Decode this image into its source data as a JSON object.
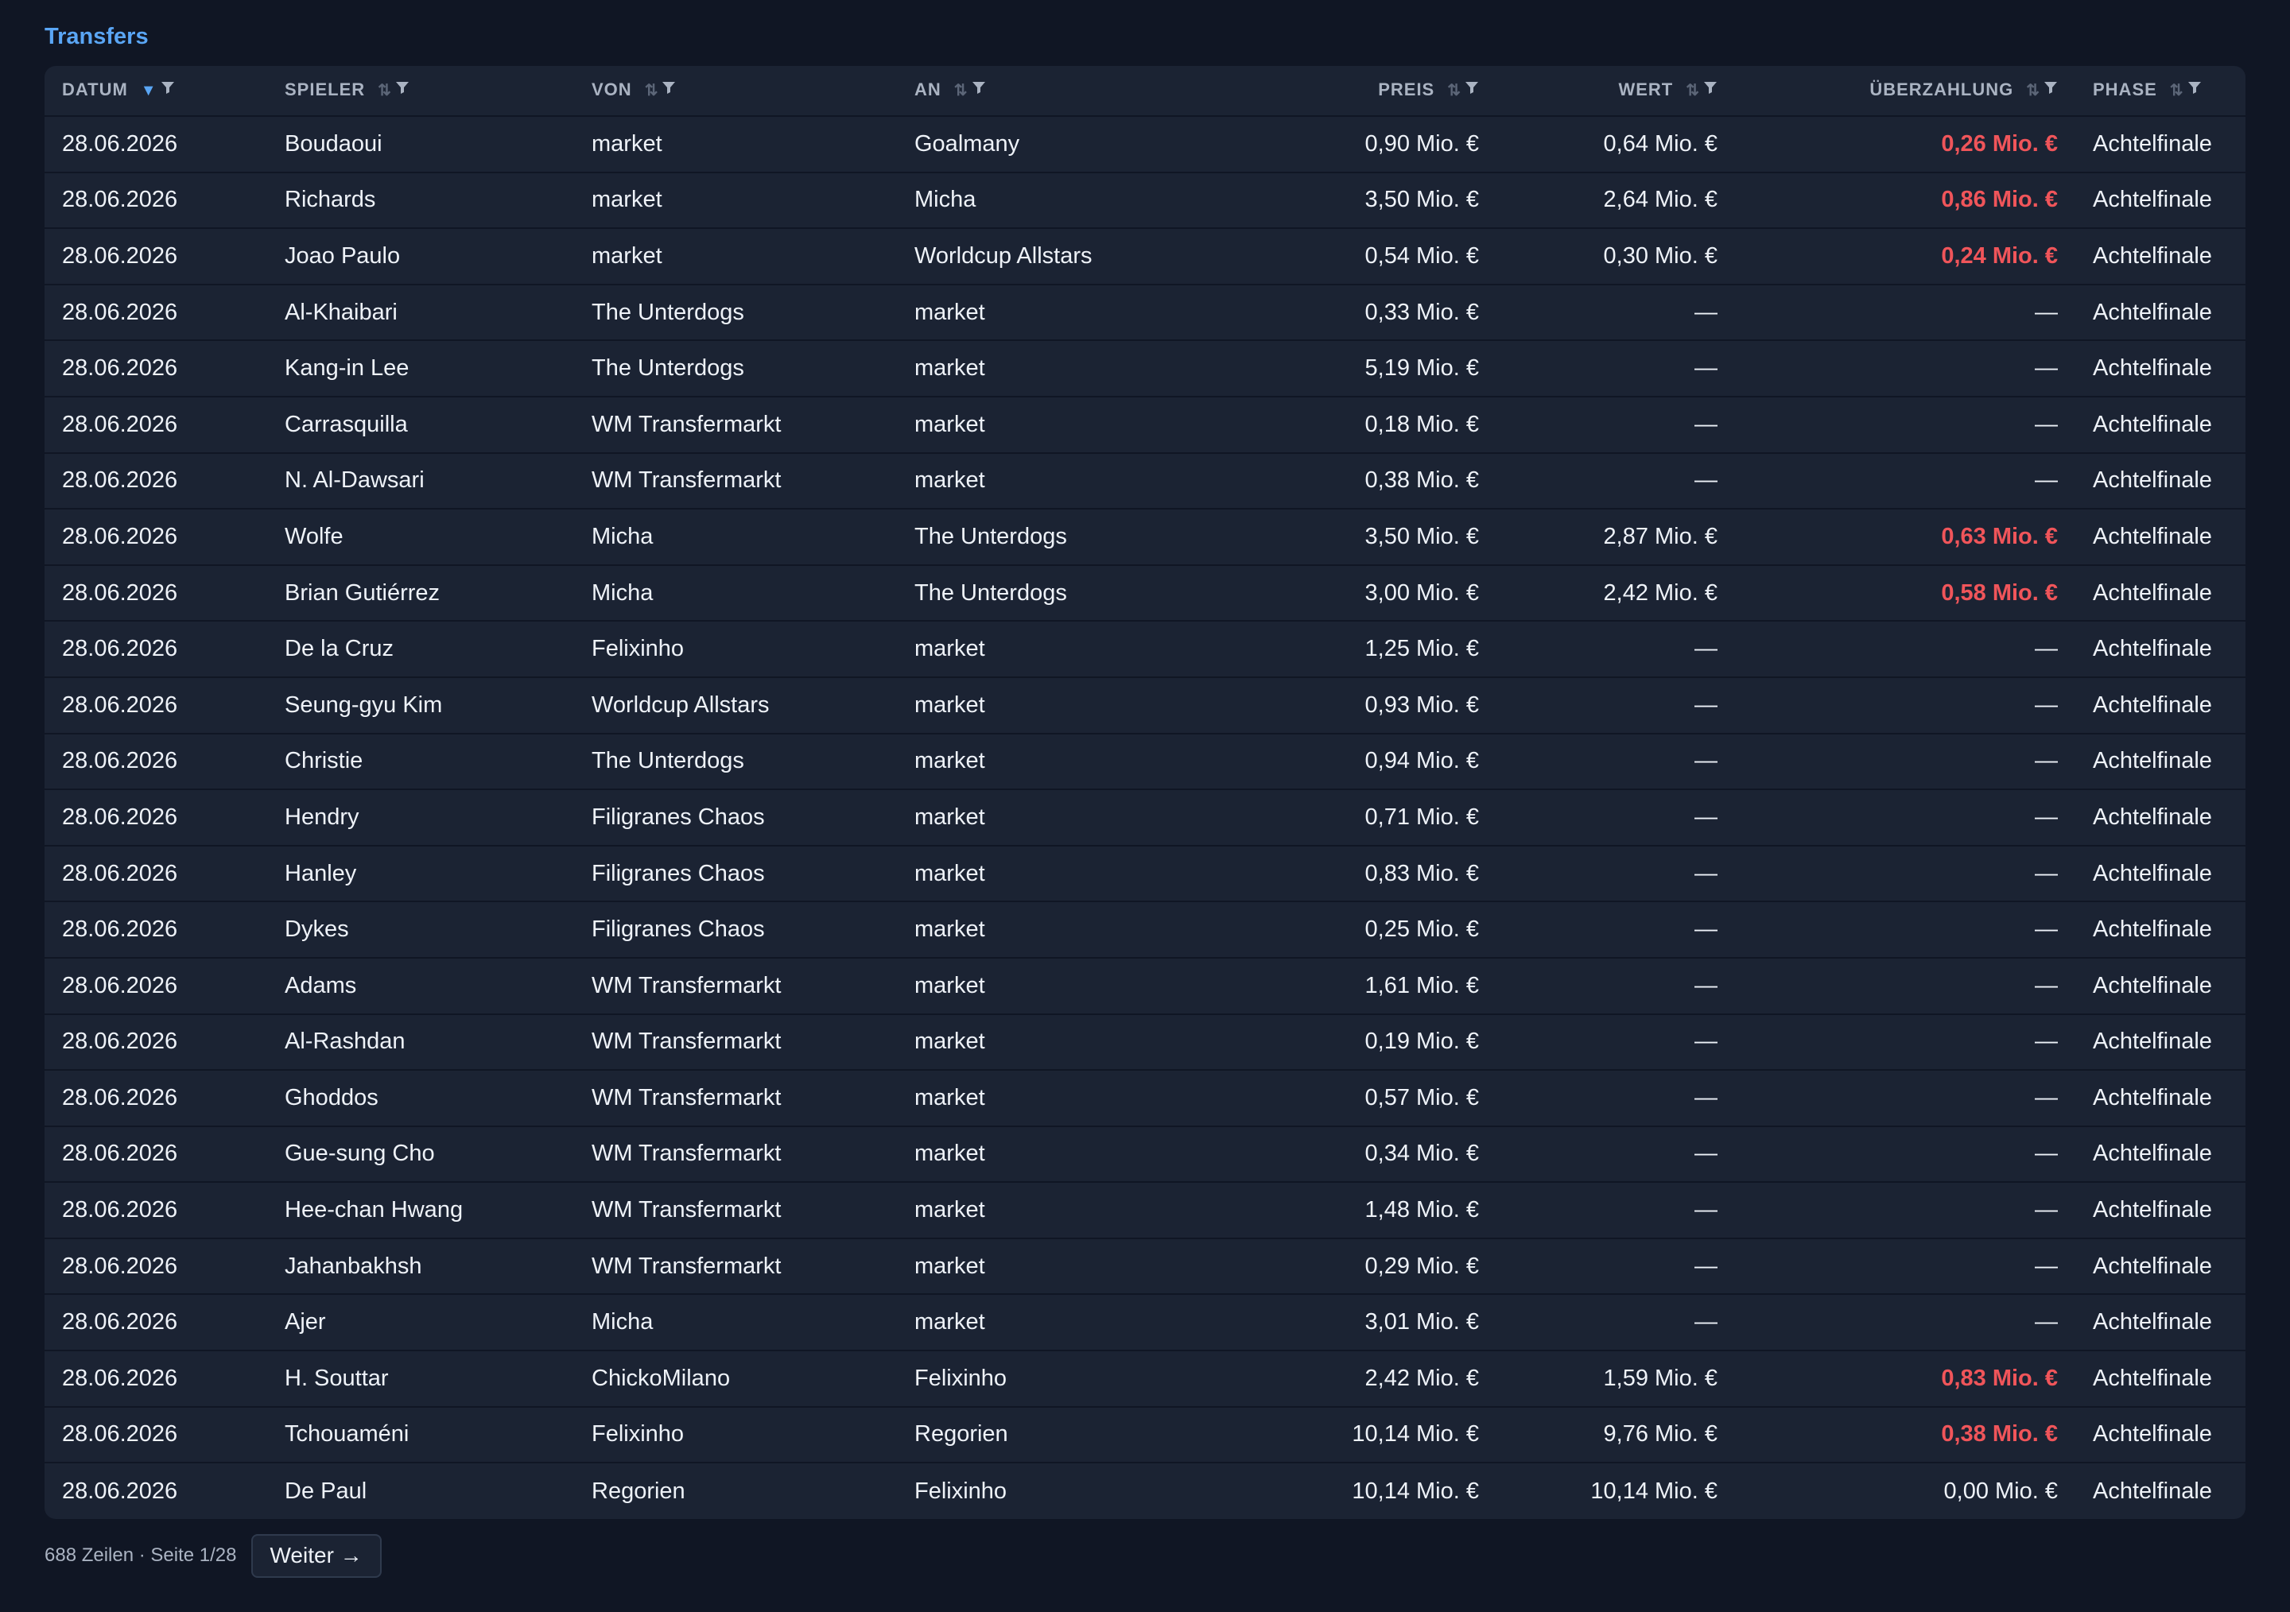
{
  "page": {
    "title": "Transfers"
  },
  "columns": [
    {
      "label": "DATUM",
      "align": "left",
      "sort": "desc"
    },
    {
      "label": "SPIELER",
      "align": "left",
      "sort": "none"
    },
    {
      "label": "VON",
      "align": "left",
      "sort": "none"
    },
    {
      "label": "AN",
      "align": "left",
      "sort": "none"
    },
    {
      "label": "PREIS",
      "align": "right",
      "sort": "none"
    },
    {
      "label": "WERT",
      "align": "right",
      "sort": "none"
    },
    {
      "label": "ÜBERZAHLUNG",
      "align": "right",
      "sort": "none"
    },
    {
      "label": "PHASE",
      "align": "left",
      "sort": "none"
    }
  ],
  "icons": {
    "sort_desc": "sort-desc-icon",
    "sort_both": "sort-both-icon",
    "filter": "filter-icon"
  },
  "colors": {
    "accent": "#5aa6f5",
    "overpay": "#f0555a",
    "background": "#101624",
    "card": "#1b2333"
  },
  "rows": [
    {
      "datum": "28.06.2026",
      "spieler": "Boudaoui",
      "von": "market",
      "an": "Goalmany",
      "preis": "0,90 Mio. €",
      "wert": "0,64 Mio. €",
      "ueberzahlung": "0,26 Mio. €",
      "overpay": true,
      "phase": "Achtelfinale"
    },
    {
      "datum": "28.06.2026",
      "spieler": "Richards",
      "von": "market",
      "an": "Micha",
      "preis": "3,50 Mio. €",
      "wert": "2,64 Mio. €",
      "ueberzahlung": "0,86 Mio. €",
      "overpay": true,
      "phase": "Achtelfinale"
    },
    {
      "datum": "28.06.2026",
      "spieler": "Joao Paulo",
      "von": "market",
      "an": "Worldcup Allstars",
      "preis": "0,54 Mio. €",
      "wert": "0,30 Mio. €",
      "ueberzahlung": "0,24 Mio. €",
      "overpay": true,
      "phase": "Achtelfinale"
    },
    {
      "datum": "28.06.2026",
      "spieler": "Al-Khaibari",
      "von": "The Unterdogs",
      "an": "market",
      "preis": "0,33 Mio. €",
      "wert": "—",
      "ueberzahlung": "—",
      "overpay": false,
      "phase": "Achtelfinale"
    },
    {
      "datum": "28.06.2026",
      "spieler": "Kang-in Lee",
      "von": "The Unterdogs",
      "an": "market",
      "preis": "5,19 Mio. €",
      "wert": "—",
      "ueberzahlung": "—",
      "overpay": false,
      "phase": "Achtelfinale"
    },
    {
      "datum": "28.06.2026",
      "spieler": "Carrasquilla",
      "von": "WM Transfermarkt",
      "an": "market",
      "preis": "0,18 Mio. €",
      "wert": "—",
      "ueberzahlung": "—",
      "overpay": false,
      "phase": "Achtelfinale"
    },
    {
      "datum": "28.06.2026",
      "spieler": "N. Al-Dawsari",
      "von": "WM Transfermarkt",
      "an": "market",
      "preis": "0,38 Mio. €",
      "wert": "—",
      "ueberzahlung": "—",
      "overpay": false,
      "phase": "Achtelfinale"
    },
    {
      "datum": "28.06.2026",
      "spieler": "Wolfe",
      "von": "Micha",
      "an": "The Unterdogs",
      "preis": "3,50 Mio. €",
      "wert": "2,87 Mio. €",
      "ueberzahlung": "0,63 Mio. €",
      "overpay": true,
      "phase": "Achtelfinale"
    },
    {
      "datum": "28.06.2026",
      "spieler": "Brian Gutiérrez",
      "von": "Micha",
      "an": "The Unterdogs",
      "preis": "3,00 Mio. €",
      "wert": "2,42 Mio. €",
      "ueberzahlung": "0,58 Mio. €",
      "overpay": true,
      "phase": "Achtelfinale"
    },
    {
      "datum": "28.06.2026",
      "spieler": "De la Cruz",
      "von": "Felixinho",
      "an": "market",
      "preis": "1,25 Mio. €",
      "wert": "—",
      "ueberzahlung": "—",
      "overpay": false,
      "phase": "Achtelfinale"
    },
    {
      "datum": "28.06.2026",
      "spieler": "Seung-gyu Kim",
      "von": "Worldcup Allstars",
      "an": "market",
      "preis": "0,93 Mio. €",
      "wert": "—",
      "ueberzahlung": "—",
      "overpay": false,
      "phase": "Achtelfinale"
    },
    {
      "datum": "28.06.2026",
      "spieler": "Christie",
      "von": "The Unterdogs",
      "an": "market",
      "preis": "0,94 Mio. €",
      "wert": "—",
      "ueberzahlung": "—",
      "overpay": false,
      "phase": "Achtelfinale"
    },
    {
      "datum": "28.06.2026",
      "spieler": "Hendry",
      "von": "Filigranes Chaos",
      "an": "market",
      "preis": "0,71 Mio. €",
      "wert": "—",
      "ueberzahlung": "—",
      "overpay": false,
      "phase": "Achtelfinale"
    },
    {
      "datum": "28.06.2026",
      "spieler": "Hanley",
      "von": "Filigranes Chaos",
      "an": "market",
      "preis": "0,83 Mio. €",
      "wert": "—",
      "ueberzahlung": "—",
      "overpay": false,
      "phase": "Achtelfinale"
    },
    {
      "datum": "28.06.2026",
      "spieler": "Dykes",
      "von": "Filigranes Chaos",
      "an": "market",
      "preis": "0,25 Mio. €",
      "wert": "—",
      "ueberzahlung": "—",
      "overpay": false,
      "phase": "Achtelfinale"
    },
    {
      "datum": "28.06.2026",
      "spieler": "Adams",
      "von": "WM Transfermarkt",
      "an": "market",
      "preis": "1,61 Mio. €",
      "wert": "—",
      "ueberzahlung": "—",
      "overpay": false,
      "phase": "Achtelfinale"
    },
    {
      "datum": "28.06.2026",
      "spieler": "Al-Rashdan",
      "von": "WM Transfermarkt",
      "an": "market",
      "preis": "0,19 Mio. €",
      "wert": "—",
      "ueberzahlung": "—",
      "overpay": false,
      "phase": "Achtelfinale"
    },
    {
      "datum": "28.06.2026",
      "spieler": "Ghoddos",
      "von": "WM Transfermarkt",
      "an": "market",
      "preis": "0,57 Mio. €",
      "wert": "—",
      "ueberzahlung": "—",
      "overpay": false,
      "phase": "Achtelfinale"
    },
    {
      "datum": "28.06.2026",
      "spieler": "Gue-sung Cho",
      "von": "WM Transfermarkt",
      "an": "market",
      "preis": "0,34 Mio. €",
      "wert": "—",
      "ueberzahlung": "—",
      "overpay": false,
      "phase": "Achtelfinale"
    },
    {
      "datum": "28.06.2026",
      "spieler": "Hee-chan Hwang",
      "von": "WM Transfermarkt",
      "an": "market",
      "preis": "1,48 Mio. €",
      "wert": "—",
      "ueberzahlung": "—",
      "overpay": false,
      "phase": "Achtelfinale"
    },
    {
      "datum": "28.06.2026",
      "spieler": "Jahanbakhsh",
      "von": "WM Transfermarkt",
      "an": "market",
      "preis": "0,29 Mio. €",
      "wert": "—",
      "ueberzahlung": "—",
      "overpay": false,
      "phase": "Achtelfinale"
    },
    {
      "datum": "28.06.2026",
      "spieler": "Ajer",
      "von": "Micha",
      "an": "market",
      "preis": "3,01 Mio. €",
      "wert": "—",
      "ueberzahlung": "—",
      "overpay": false,
      "phase": "Achtelfinale"
    },
    {
      "datum": "28.06.2026",
      "spieler": "H. Souttar",
      "von": "ChickoMilano",
      "an": "Felixinho",
      "preis": "2,42 Mio. €",
      "wert": "1,59 Mio. €",
      "ueberzahlung": "0,83 Mio. €",
      "overpay": true,
      "phase": "Achtelfinale"
    },
    {
      "datum": "28.06.2026",
      "spieler": "Tchouaméni",
      "von": "Felixinho",
      "an": "Regorien",
      "preis": "10,14 Mio. €",
      "wert": "9,76 Mio. €",
      "ueberzahlung": "0,38 Mio. €",
      "overpay": true,
      "phase": "Achtelfinale"
    },
    {
      "datum": "28.06.2026",
      "spieler": "De Paul",
      "von": "Regorien",
      "an": "Felixinho",
      "preis": "10,14 Mio. €",
      "wert": "10,14 Mio. €",
      "ueberzahlung": "0,00 Mio. €",
      "overpay": false,
      "phase": "Achtelfinale"
    }
  ],
  "pagination": {
    "info": "688 Zeilen · Seite 1/28",
    "next_label": "Weiter →"
  }
}
